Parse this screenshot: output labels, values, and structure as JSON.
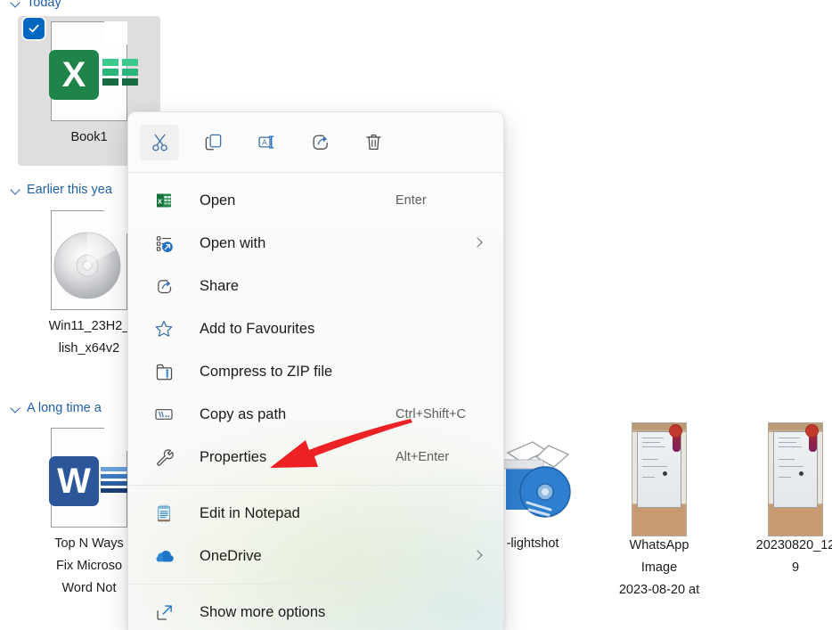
{
  "window": {
    "app": "File Explorer",
    "background_color": "#ffffff"
  },
  "groups": [
    {
      "label": "Today",
      "clipped": true
    },
    {
      "label": "Earlier this yea",
      "full_label": "Earlier this year"
    },
    {
      "label": "A long time a",
      "full_label": "A long time ago"
    }
  ],
  "files": [
    {
      "name": "Book1",
      "type": "excel-workbook",
      "selected": true,
      "badge_letter": "X",
      "badge_color": "#1e8449"
    },
    {
      "name": "Win11_23H2_\nlish_x64v2",
      "type": "disc-image",
      "selected": false
    },
    {
      "name": "Top N Ways\nFix Microso\nWord Not",
      "type": "word-document",
      "selected": false,
      "badge_letter": "W",
      "badge_color": "#2b579a"
    },
    {
      "name": "-lightshot",
      "type": "installer-package",
      "selected": false
    },
    {
      "name": "WhatsApp\nImage\n2023-08-20 at",
      "type": "photo",
      "selected": false
    },
    {
      "name": "20230820_12\n9",
      "type": "photo",
      "selected": false
    }
  ],
  "context_menu": {
    "command_bar": [
      {
        "icon": "cut-icon",
        "label": "Cut",
        "hovered": true
      },
      {
        "icon": "copy-icon",
        "label": "Copy",
        "hovered": false
      },
      {
        "icon": "rename-icon",
        "label": "Rename",
        "hovered": false
      },
      {
        "icon": "share-icon",
        "label": "Share",
        "hovered": false
      },
      {
        "icon": "delete-icon",
        "label": "Delete",
        "hovered": false
      }
    ],
    "items": [
      {
        "icon": "excel-icon",
        "label": "Open",
        "accel": "Enter",
        "submenu": false
      },
      {
        "icon": "open-with-icon",
        "label": "Open with",
        "accel": "",
        "submenu": true
      },
      {
        "icon": "share-icon",
        "label": "Share",
        "accel": "",
        "submenu": false
      },
      {
        "icon": "star-icon",
        "label": "Add to Favourites",
        "accel": "",
        "submenu": false
      },
      {
        "icon": "zip-icon",
        "label": "Compress to ZIP file",
        "accel": "",
        "submenu": false
      },
      {
        "icon": "path-icon",
        "label": "Copy as path",
        "accel": "Ctrl+Shift+C",
        "submenu": false
      },
      {
        "icon": "wrench-icon",
        "label": "Properties",
        "accel": "Alt+Enter",
        "submenu": false
      }
    ],
    "items_secondary": [
      {
        "icon": "notepad-icon",
        "label": "Edit in Notepad",
        "accel": "",
        "submenu": false
      },
      {
        "icon": "onedrive-icon",
        "label": "OneDrive",
        "accel": "",
        "submenu": true
      }
    ],
    "items_footer": [
      {
        "icon": "expand-icon",
        "label": "Show more options",
        "accel": "",
        "submenu": false
      }
    ]
  },
  "annotation": {
    "type": "arrow",
    "color": "#ed2024",
    "points_to": "Properties"
  }
}
